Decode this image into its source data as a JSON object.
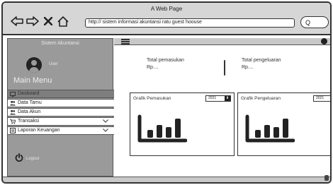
{
  "window": {
    "title": "A Web Page"
  },
  "browser": {
    "url": "http:// sistem informasi akuntansi ratu guest hoouse",
    "search_glyph": "Q"
  },
  "sidebar": {
    "brand": "Sistem Akuntansi",
    "user_label": "User",
    "main_menu": "Main Menu",
    "items": [
      {
        "label": "Dasboard",
        "icon": "dashboard-icon",
        "active": true,
        "expandable": false
      },
      {
        "label": "Data Tamu",
        "icon": "users-icon",
        "active": false,
        "expandable": false
      },
      {
        "label": "Data Akun",
        "icon": "users-icon",
        "active": false,
        "expandable": false
      },
      {
        "label": "Transaksi",
        "icon": "cart-icon",
        "active": false,
        "expandable": true
      },
      {
        "label": "Laporan Keuangan",
        "icon": "report-icon",
        "active": false,
        "expandable": true
      }
    ],
    "logout_label": "Logout"
  },
  "stats": {
    "income_label": "Total pemasukan",
    "income_value": "Rp....",
    "expense_label": "Total pengeluaran",
    "expense_value": "Rp...."
  },
  "cards": {
    "income": {
      "title": "Grafik Pemasukan",
      "year": "2021"
    },
    "expense": {
      "title": "Grafik Pengeluaran",
      "year": "2021"
    }
  },
  "colors": {
    "sidebar_bg": "#9a9a9a",
    "chrome_bg": "#d6d6d6",
    "active_item": "#7e7e7e"
  }
}
